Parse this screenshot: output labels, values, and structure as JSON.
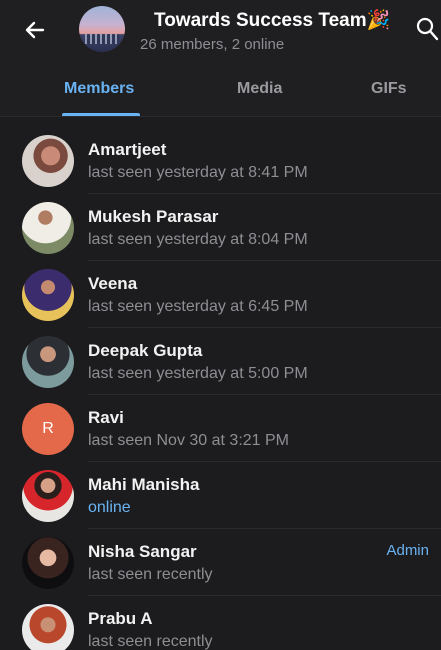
{
  "header": {
    "title": "Towards Success Team",
    "title_emoji": "🎉",
    "subtitle": "26 members, 2 online"
  },
  "tabs": [
    {
      "label": "Members",
      "active": true
    },
    {
      "label": "Media",
      "active": false
    },
    {
      "label": "GIFs",
      "active": false
    }
  ],
  "members": [
    {
      "name": "Amartjeet",
      "status": "last seen yesterday at 8:41 PM",
      "avatar": "photo"
    },
    {
      "name": "Mukesh Parasar",
      "status": "last seen yesterday at 8:04 PM",
      "avatar": "photo"
    },
    {
      "name": "Veena",
      "status": "last seen yesterday at 6:45 PM",
      "avatar": "photo"
    },
    {
      "name": "Deepak Gupta",
      "status": "last seen yesterday at 5:00 PM",
      "avatar": "photo"
    },
    {
      "name": "Ravi",
      "status": "last seen Nov 30 at 3:21 PM",
      "avatar": "letter",
      "initial": "R"
    },
    {
      "name": "Mahi Manisha",
      "status": "online",
      "avatar": "photo"
    },
    {
      "name": "Nisha Sangar",
      "status": "last seen recently",
      "badge": "Admin",
      "avatar": "photo"
    },
    {
      "name": "Prabu A",
      "status": "last seen recently",
      "avatar": "photo"
    }
  ],
  "colors": {
    "accent": "#6ab3f3",
    "background": "#1c1c1e",
    "letter_avatar": "#e3694a"
  },
  "icons": [
    "back-arrow-icon",
    "search-icon"
  ]
}
